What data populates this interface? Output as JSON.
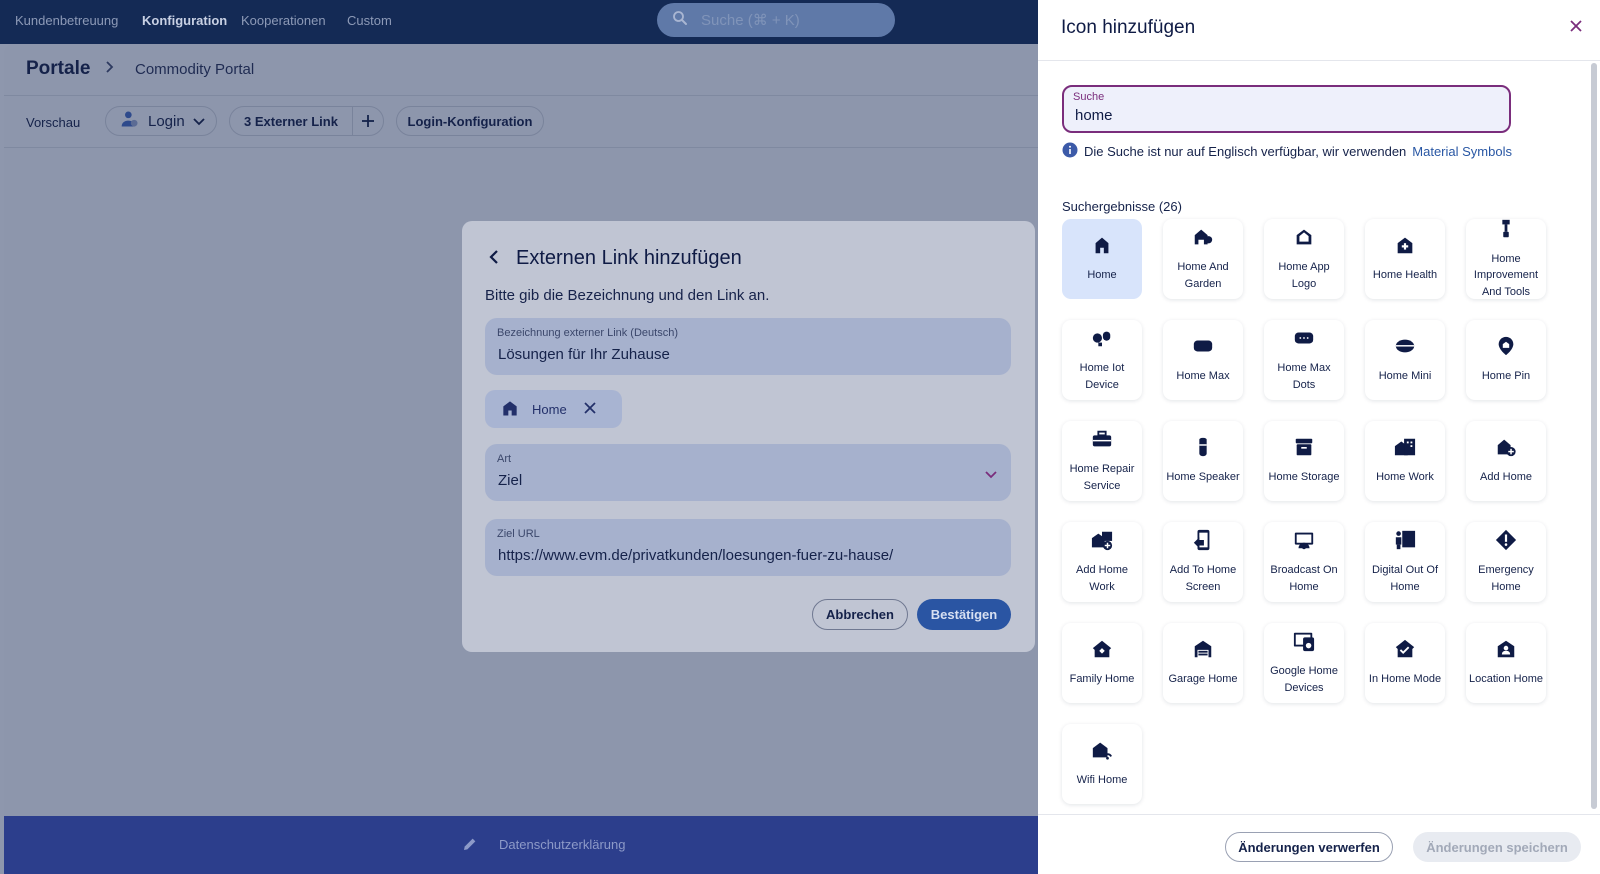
{
  "topnav": {
    "items": [
      "Kundenbetreuung",
      "Konfiguration",
      "Kooperationen",
      "Custom"
    ],
    "active_index": 1,
    "search_placeholder": "Suche (⌘ + K)"
  },
  "breadcrumb": {
    "root": "Portale",
    "current": "Commodity Portal"
  },
  "toolbar": {
    "preview_label": "Vorschau",
    "login_label": "Login",
    "external_link_label": "3 Externer Link",
    "login_config_label": "Login-Konfiguration"
  },
  "footer": {
    "privacy_label": "Datenschutzerklärung"
  },
  "modal": {
    "title": "Externen Link hinzufügen",
    "subtitle": "Bitte gib die Bezeichnung und den Link an.",
    "name_field": {
      "label": "Bezeichnung externer Link (Deutsch)",
      "value": "Lösungen für Ihr Zuhause"
    },
    "icon_chip": {
      "label": "Home",
      "icon": "home-icon"
    },
    "type_field": {
      "label": "Art",
      "value": "Ziel"
    },
    "url_field": {
      "label": "Ziel URL",
      "value": "https://www.evm.de/privatkunden/loesungen-fuer-zu-hause/"
    },
    "cancel_label": "Abbrechen",
    "confirm_label": "Bestätigen"
  },
  "panel": {
    "title": "Icon hinzufügen",
    "search": {
      "label": "Suche",
      "value": "home"
    },
    "info_text": "Die Suche ist nur auf Englisch verfügbar, wir verwenden",
    "info_link": "Material Symbols",
    "results_title": "Suchergebnisse (26)",
    "results": [
      {
        "label": "Home",
        "icon": "home-icon",
        "selected": true
      },
      {
        "label": "Home And Garden",
        "icon": "home-and-garden-icon"
      },
      {
        "label": "Home App Logo",
        "icon": "home-app-logo-icon"
      },
      {
        "label": "Home Health",
        "icon": "home-health-icon"
      },
      {
        "label": "Home Improvement And Tools",
        "icon": "home-improvement-and-tools-icon"
      },
      {
        "label": "Home Iot Device",
        "icon": "home-iot-device-icon"
      },
      {
        "label": "Home Max",
        "icon": "home-max-icon"
      },
      {
        "label": "Home Max Dots",
        "icon": "home-max-dots-icon"
      },
      {
        "label": "Home Mini",
        "icon": "home-mini-icon"
      },
      {
        "label": "Home Pin",
        "icon": "home-pin-icon"
      },
      {
        "label": "Home Repair Service",
        "icon": "home-repair-service-icon"
      },
      {
        "label": "Home Speaker",
        "icon": "home-speaker-icon"
      },
      {
        "label": "Home Storage",
        "icon": "home-storage-icon"
      },
      {
        "label": "Home Work",
        "icon": "home-work-icon"
      },
      {
        "label": "Add Home",
        "icon": "add-home-icon"
      },
      {
        "label": "Add Home Work",
        "icon": "add-home-work-icon"
      },
      {
        "label": "Add To Home Screen",
        "icon": "add-to-home-screen-icon"
      },
      {
        "label": "Broadcast On Home",
        "icon": "broadcast-on-home-icon"
      },
      {
        "label": "Digital Out Of Home",
        "icon": "digital-out-of-home-icon"
      },
      {
        "label": "Emergency Home",
        "icon": "emergency-home-icon"
      },
      {
        "label": "Family Home",
        "icon": "family-home-icon"
      },
      {
        "label": "Garage Home",
        "icon": "garage-home-icon"
      },
      {
        "label": "Google Home Devices",
        "icon": "google-home-devices-icon"
      },
      {
        "label": "In Home Mode",
        "icon": "in-home-mode-icon"
      },
      {
        "label": "Location Home",
        "icon": "location-home-icon"
      },
      {
        "label": "Wifi Home",
        "icon": "wifi-home-icon"
      }
    ],
    "discard_label": "Änderungen verwerfen",
    "save_label": "Änderungen speichern"
  },
  "colors": {
    "accent": "#2a55a3",
    "focus": "#7a2d7c",
    "nav": "#142a55",
    "tile_selected": "#d8e4fb"
  }
}
